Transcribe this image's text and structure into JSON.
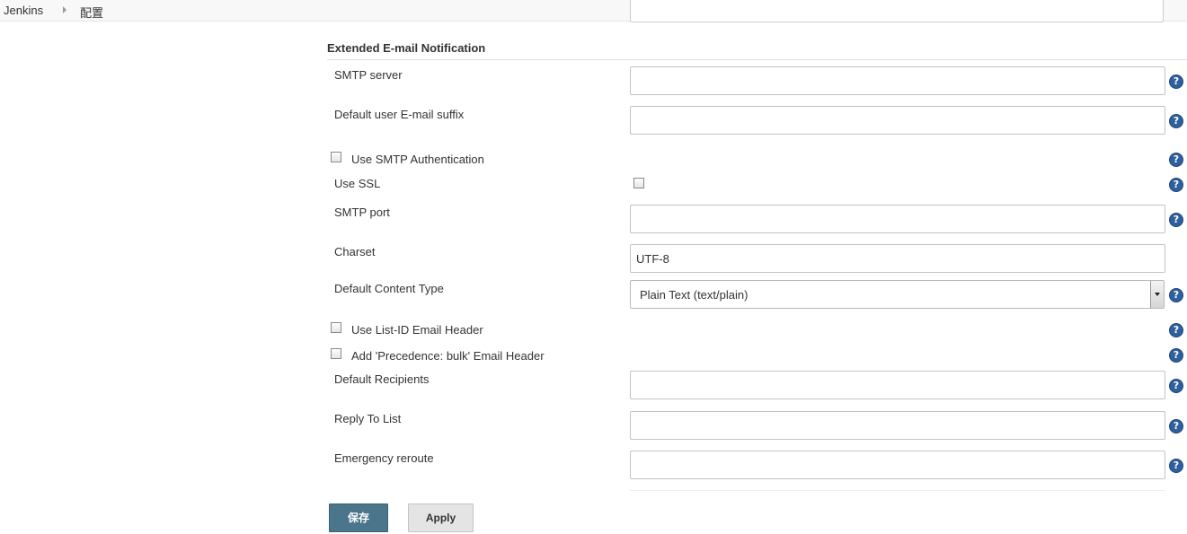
{
  "breadcrumb": {
    "root": "Jenkins",
    "current": "配置"
  },
  "section": {
    "title": "Extended E-mail Notification"
  },
  "fields": {
    "smtp_server": {
      "label": "SMTP server",
      "value": ""
    },
    "default_suffix": {
      "label": "Default user E-mail suffix",
      "value": ""
    },
    "use_smtp_auth": {
      "label": "Use SMTP Authentication",
      "checked": false
    },
    "use_ssl": {
      "label": "Use SSL",
      "checked": false
    },
    "smtp_port": {
      "label": "SMTP port",
      "value": ""
    },
    "charset": {
      "label": "Charset",
      "value": "UTF-8"
    },
    "content_type": {
      "label": "Default Content Type",
      "selected": "Plain Text (text/plain)"
    },
    "use_list_id": {
      "label": "Use List-ID Email Header",
      "checked": false
    },
    "precedence_bulk": {
      "label": "Add 'Precedence: bulk' Email Header",
      "checked": false
    },
    "default_recipients": {
      "label": "Default Recipients",
      "value": ""
    },
    "reply_to": {
      "label": "Reply To List",
      "value": ""
    },
    "emergency_reroute": {
      "label": "Emergency reroute",
      "value": ""
    }
  },
  "help_icon": {
    "glyph": "?"
  },
  "buttons": {
    "save": "保存",
    "apply": "Apply"
  },
  "colors": {
    "save_button": "#4b758b",
    "help_icon": "#2e5f9e"
  }
}
